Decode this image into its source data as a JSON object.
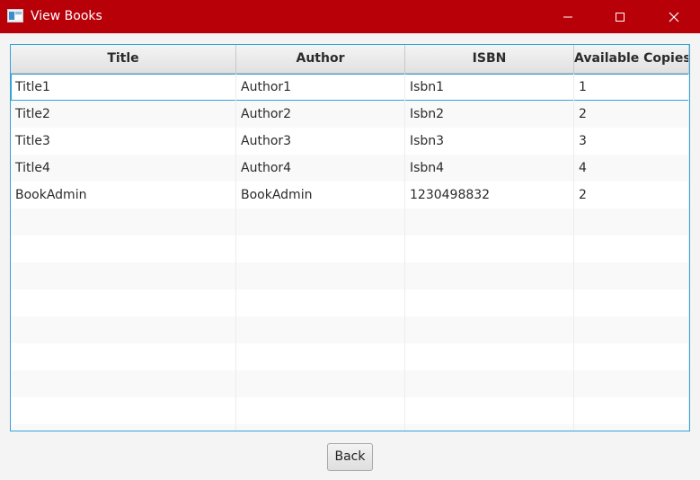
{
  "window": {
    "title": "View Books",
    "accent": "#b80009"
  },
  "icons": {
    "app": "app-window-icon",
    "minimize": "minimize-icon",
    "maximize": "maximize-icon",
    "close": "close-icon"
  },
  "table": {
    "columns": [
      "Title",
      "Author",
      "ISBN",
      "Available Copies"
    ],
    "rows": [
      [
        "Title1",
        "Author1",
        "Isbn1",
        "1"
      ],
      [
        "Title2",
        "Author2",
        "Isbn2",
        "2"
      ],
      [
        "Title3",
        "Author3",
        "Isbn3",
        "3"
      ],
      [
        "Title4",
        "Author4",
        "Isbn4",
        "4"
      ],
      [
        "BookAdmin",
        "BookAdmin",
        "1230498832",
        "2"
      ]
    ],
    "selected_row": 0,
    "border_color": "#33a3dc"
  },
  "buttons": {
    "back": "Back"
  }
}
